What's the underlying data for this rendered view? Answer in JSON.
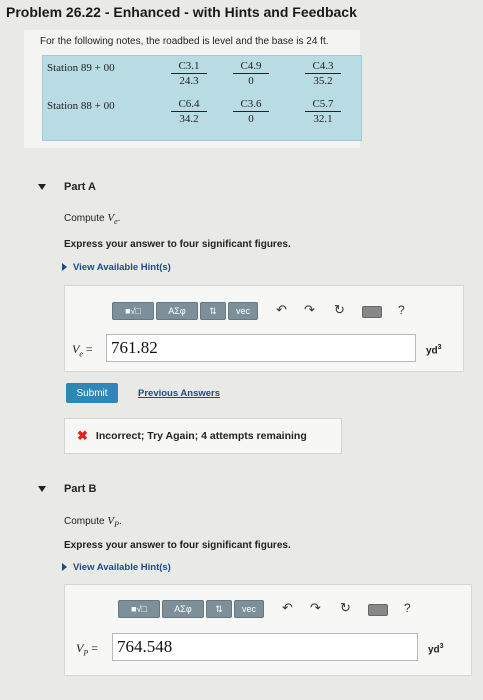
{
  "title": "Problem 26.22 - Enhanced - with Hints and Feedback",
  "problem": {
    "text": "For the following notes, the roadbed is level and the base is 24 ft.",
    "rows": [
      {
        "station": "Station 89 + 00",
        "notes": [
          {
            "num": "C3.1",
            "den": "24.3"
          },
          {
            "num": "C4.9",
            "den": "0"
          },
          {
            "num": "C4.3",
            "den": "35.2"
          }
        ]
      },
      {
        "station": "Station 88 + 00",
        "notes": [
          {
            "num": "C6.4",
            "den": "34.2"
          },
          {
            "num": "C3.6",
            "den": "0"
          },
          {
            "num": "C5.7",
            "den": "32.1"
          }
        ]
      }
    ]
  },
  "partA": {
    "header": "Part A",
    "compute_prefix": "Compute",
    "variable": "V",
    "subscript": "e",
    "compute_suffix": ".",
    "express": "Express your answer to four significant figures.",
    "hints": "View Available Hint(s)",
    "label": "V",
    "label_sub": "e",
    "equals": " =",
    "value": "761.82",
    "unit": "yd",
    "unit_sup": "3",
    "submit": "Submit",
    "previous": "Previous Answers",
    "feedback": "Incorrect; Try Again; 4 attempts remaining"
  },
  "partB": {
    "header": "Part B",
    "compute_prefix": "Compute",
    "variable": "V",
    "subscript": "P",
    "compute_suffix": ".",
    "express": "Express your answer to four significant figures.",
    "hints": "View Available Hint(s)",
    "label": "V",
    "label_sub": "P",
    "equals": " =",
    "value": "764.548",
    "unit": "yd",
    "unit_sup": "3"
  },
  "toolbar": {
    "templates": "■√□",
    "greek": "ΑΣφ",
    "arrows": "⇅",
    "vec": "vec",
    "undo": "↶",
    "redo": "↷",
    "reset": "↻",
    "help": "?"
  }
}
